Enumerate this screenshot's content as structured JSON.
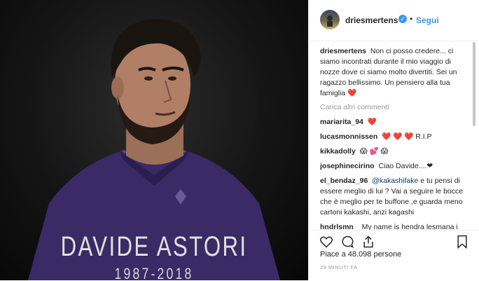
{
  "photo": {
    "name": "DAVIDE ASTORI",
    "years": "1987-2018"
  },
  "header": {
    "username": "driesmertens",
    "verified_glyph": "✓",
    "separator": "•",
    "follow_label": "Segui"
  },
  "caption": {
    "username": "driesmertens",
    "text": "Non ci posso credere... ci siamo incontrati durante il mio viaggio di nozze dove ci siamo molto divertiti. Sei un ragazzo bellissimo. Un pensiero alla tua famiglia",
    "emoji": "❤️"
  },
  "load_more_label": "Carica altri commenti",
  "comments": [
    {
      "username": "mariarita_94",
      "text": "",
      "emoji": "❤️"
    },
    {
      "username": "lucasmonnissen",
      "text": "R.I.P",
      "emoji": "❤️ ❤️ ❤️"
    },
    {
      "username": "kikkadolly",
      "text": "",
      "emoji": "😱 💕 😱"
    },
    {
      "username": "josephinecirino",
      "text": "Ciao Davide....❤",
      "emoji": ""
    },
    {
      "username": "el_bendaz_96",
      "mention": "@kakashifake",
      "text": "e tu pensi di essere meglio di lui ? Vai a seguire le bocce che è meglio per te buffone ,e guarda meno cartoni kakashi, anzi kagashi"
    },
    {
      "username": "hndrlsmn_",
      "text": "My name is hendra lesmana i from indonesia im fans you"
    }
  ],
  "actions": {
    "like_icon": "heart-outline-icon",
    "comment_icon": "speech-bubble-icon",
    "share_icon": "share-upload-icon",
    "bookmark_icon": "bookmark-icon"
  },
  "likes_text": "Piace a 48.098 persone",
  "time_text": "29 MINUTI FA",
  "colors": {
    "link_blue": "#3897f0",
    "heart_red": "#ed4956",
    "photo_bg": "#0d0d0d",
    "jersey_purple": "#3a2a66"
  }
}
